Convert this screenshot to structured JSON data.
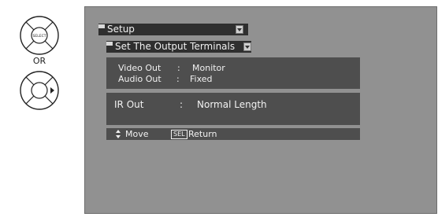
{
  "remote": {
    "select_label": "SELECT",
    "or_label": "OR"
  },
  "menu": {
    "setup_label": "Setup",
    "submenu_label": "Set  The Output Terminals"
  },
  "settings": {
    "video_out": {
      "label": "Video Out",
      "separator": ":",
      "value": "Monitor"
    },
    "audio_out": {
      "label": "Audio Out",
      "separator": ":",
      "value": "Fixed"
    },
    "ir_out": {
      "label": "IR Out",
      "separator": ":",
      "value": "Normal Length"
    }
  },
  "hints": {
    "move_label": "Move",
    "sel_key": "SEL",
    "return_label": "Return"
  },
  "colors": {
    "screen_bg": "#919191",
    "bar_bg": "#2f2f2f",
    "panel_bg": "#4e4e4e"
  }
}
